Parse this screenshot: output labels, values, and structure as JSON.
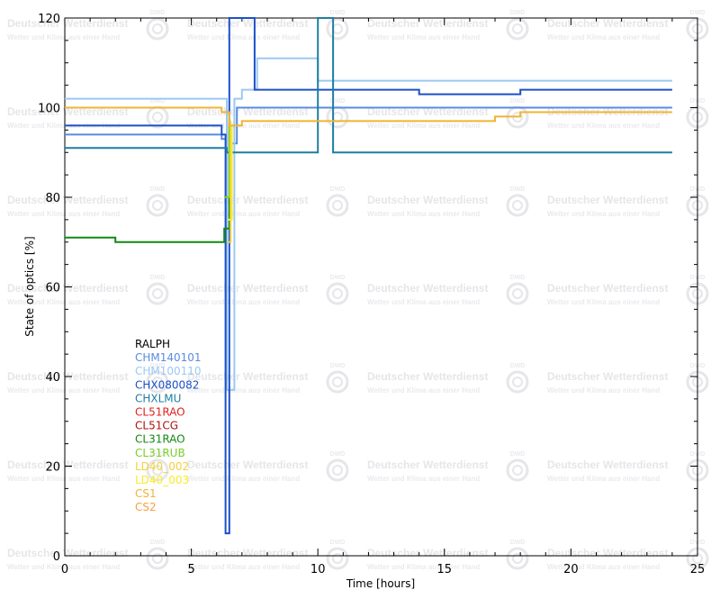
{
  "chart_data": {
    "type": "line",
    "title": "",
    "xlabel": "Time [hours]",
    "ylabel": "State of optics [%]",
    "xlim": [
      0,
      25
    ],
    "ylim": [
      0,
      120
    ],
    "x_ticks": [
      "0",
      "5",
      "10",
      "15",
      "20",
      "25"
    ],
    "y_ticks": [
      "0",
      "20",
      "40",
      "60",
      "80",
      "100",
      "120"
    ],
    "legend_position": "left-center",
    "watermark": {
      "title": "Deutscher Wetterdienst",
      "subtitle": "Wetter und Klima aus einer Hand",
      "logo": "DWD"
    },
    "series": [
      {
        "name": "RALPH",
        "color": "#000000",
        "x": [],
        "y": []
      },
      {
        "name": "CHM140101",
        "color": "#5b8be0",
        "x": [
          0,
          6.2,
          6.4,
          6.6,
          6.8,
          7.5,
          10,
          14,
          18,
          20,
          24
        ],
        "y": [
          94,
          93,
          90,
          92,
          100,
          100,
          100,
          100,
          100,
          100,
          100
        ]
      },
      {
        "name": "CHM100110",
        "color": "#9cc8f2",
        "x": [
          0,
          6.2,
          6.4,
          6.7,
          7,
          7.6,
          9.2,
          10,
          12,
          14,
          18,
          22,
          24
        ],
        "y": [
          102,
          102,
          37,
          102,
          104,
          111,
          111,
          106,
          106,
          106,
          106,
          106,
          106
        ]
      },
      {
        "name": "CHX080082",
        "color": "#1c50c8",
        "x": [
          0,
          3,
          6.2,
          6.35,
          6.5,
          6.6,
          7.4,
          7.5,
          10,
          14,
          18,
          22,
          24
        ],
        "y": [
          96,
          96,
          94,
          5,
          120,
          120,
          120,
          104,
          104,
          103,
          104,
          104,
          104
        ]
      },
      {
        "name": "CHXLMU",
        "color": "#1f7ea3",
        "x": [
          0,
          6.2,
          6.4,
          6.6,
          9.2,
          9.8,
          10,
          10.6,
          11.8,
          12,
          24
        ],
        "y": [
          91,
          91,
          90,
          90,
          90,
          90,
          120,
          90,
          90,
          90,
          90
        ]
      },
      {
        "name": "CL51RAO",
        "color": "#e02020",
        "x": [],
        "y": []
      },
      {
        "name": "CL51CG",
        "color": "#b01010",
        "x": [],
        "y": []
      },
      {
        "name": "CL31RAO",
        "color": "#108a10",
        "x": [
          0,
          2,
          4,
          6.2,
          6.3,
          6.5
        ],
        "y": [
          71,
          70,
          70,
          70,
          73,
          95
        ]
      },
      {
        "name": "CL31RUB",
        "color": "#7ccd2a",
        "x": [
          6.3,
          6.5
        ],
        "y": [
          80,
          98
        ]
      },
      {
        "name": "LD40_002",
        "color": "#f0d23c",
        "x": [
          6.4,
          6.55
        ],
        "y": [
          70,
          97
        ]
      },
      {
        "name": "LD40_003",
        "color": "#f8ec28",
        "x": [
          6.45,
          6.6
        ],
        "y": [
          75,
          96
        ]
      },
      {
        "name": "CS1",
        "color": "#f0b434",
        "x": [
          0,
          3,
          6.2,
          6.5,
          7,
          10,
          14,
          17,
          18,
          24
        ],
        "y": [
          100,
          100,
          99,
          96,
          97,
          97,
          97,
          98,
          99,
          99
        ]
      },
      {
        "name": "CS2",
        "color": "#f4a040",
        "x": [],
        "y": []
      }
    ]
  }
}
